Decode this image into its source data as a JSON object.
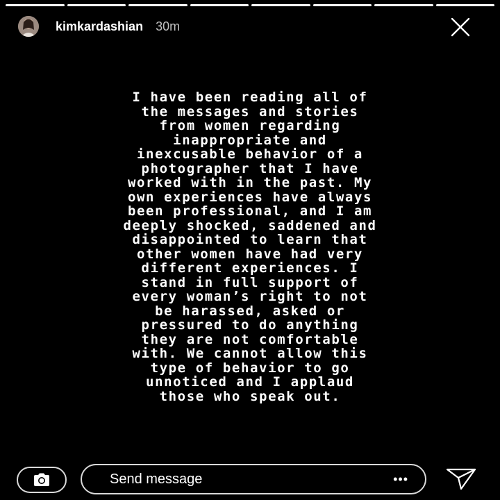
{
  "progress": {
    "segments_total": 8,
    "segments_complete": 8
  },
  "header": {
    "username": "kimkardashian",
    "timestamp": "30m",
    "avatar_icon": "profile-avatar"
  },
  "story": {
    "lines": [
      "I have been reading all of",
      "the messages and stories",
      "from women regarding",
      "inappropriate and",
      "inexcusable behavior of a",
      "photographer that I have",
      "worked with in the past. My",
      "own experiences have always",
      "been professional, and I am",
      "deeply shocked, saddened and",
      "disappointed to learn that",
      "other women have had very",
      "different experiences. I",
      "stand in full support of",
      "every woman’s right to not",
      "be harassed, asked or",
      "pressured to do anything",
      "they are not comfortable",
      "with. We cannot allow this",
      "type of behavior to go",
      "unnoticed and I applaud",
      "those who speak out."
    ]
  },
  "footer": {
    "message_placeholder": "Send message",
    "more_label": "•••",
    "camera_icon": "camera-icon",
    "send_icon": "send-icon"
  },
  "colors": {
    "background": "#000000",
    "text": "#ffffff"
  }
}
